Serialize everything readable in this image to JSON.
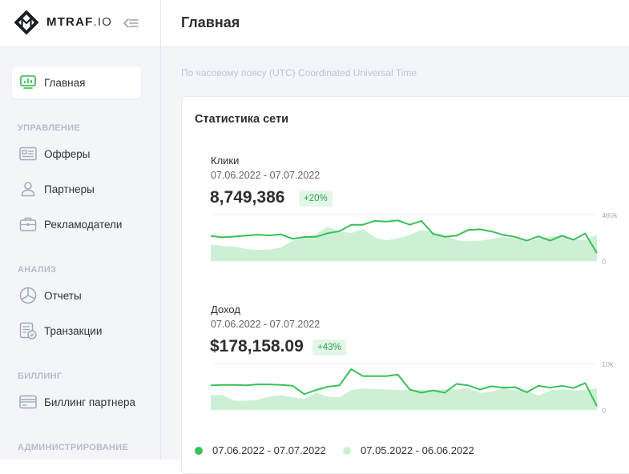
{
  "brand": {
    "name_bold": "MTRAF",
    "name_thin": ".IO"
  },
  "sidebar": {
    "home": {
      "label": "Главная",
      "icon": "dashboard-icon"
    },
    "sections": [
      {
        "title": "УПРАВЛЕНИЕ",
        "items": [
          {
            "label": "Офферы",
            "icon": "offers-card-icon"
          },
          {
            "label": "Партнеры",
            "icon": "user-icon"
          },
          {
            "label": "Рекламодатели",
            "icon": "briefcase-icon"
          }
        ]
      },
      {
        "title": "АНАЛИЗ",
        "items": [
          {
            "label": "Отчеты",
            "icon": "pie-chart-icon"
          },
          {
            "label": "Транзакции",
            "icon": "transactions-icon"
          }
        ]
      },
      {
        "title": "БИЛЛИНГ",
        "items": [
          {
            "label": "Биллинг партнера",
            "icon": "credit-card-icon"
          }
        ]
      },
      {
        "title": "АДМИНИСТРИРОВАНИЕ",
        "items": []
      }
    ]
  },
  "header": {
    "title": "Главная"
  },
  "main": {
    "timezone_note": "По часовому поясу (UTC) Coordinated Universal Time",
    "card": {
      "title": "Статистика сети",
      "metrics": [
        {
          "label": "Клики",
          "date_range": "07.06.2022 - 07.07.2022",
          "value": "8,749,386",
          "change": "+20%",
          "y_max_label": "480k",
          "y_min_label": "0"
        },
        {
          "label": "Доход",
          "date_range": "07.06.2022 - 07.07.2022",
          "value": "$178,158.09",
          "change": "+43%",
          "y_max_label": "10k",
          "y_min_label": "0"
        }
      ],
      "legend": [
        {
          "label": "07.06.2022 - 07.07.2022",
          "color": "#39c05a"
        },
        {
          "label": "07.05.2022 - 06.06.2022",
          "color": "#cdf0d5"
        }
      ]
    }
  },
  "chart_data": [
    {
      "type": "area",
      "title": "Клики",
      "ylim": [
        0,
        480000
      ],
      "series": [
        {
          "name": "07.06.2022 - 07.07.2022",
          "values": [
            260000,
            245000,
            252000,
            262000,
            272000,
            265000,
            275000,
            230000,
            248000,
            250000,
            288000,
            308000,
            375000,
            375000,
            415000,
            408000,
            420000,
            375000,
            415000,
            280000,
            250000,
            262000,
            320000,
            328000,
            305000,
            270000,
            250000,
            210000,
            255000,
            210000,
            262000,
            220000,
            285000,
            80000
          ]
        },
        {
          "name": "07.05.2022 - 06.06.2022",
          "values": [
            170000,
            155000,
            150000,
            125000,
            115000,
            118000,
            140000,
            210000,
            245000,
            280000,
            355000,
            305000,
            290000,
            330000,
            245000,
            215000,
            235000,
            270000,
            320000,
            300000,
            270000,
            215000,
            205000,
            210000,
            230000,
            245000,
            240000,
            205000,
            230000,
            255000,
            260000,
            230000,
            215000,
            270000
          ]
        }
      ]
    },
    {
      "type": "area",
      "title": "Доход",
      "ylim": [
        0,
        10000
      ],
      "series": [
        {
          "name": "07.06.2022 - 07.07.2022",
          "values": [
            5300,
            5400,
            5400,
            5300,
            5500,
            5500,
            5400,
            5200,
            3400,
            4300,
            5000,
            5300,
            8800,
            7300,
            7300,
            7300,
            7600,
            4400,
            3700,
            4200,
            3700,
            5600,
            5300,
            4400,
            5100,
            4800,
            4900,
            3800,
            5200,
            4800,
            5200,
            4700,
            5800,
            800
          ]
        },
        {
          "name": "07.05.2022 - 06.06.2022",
          "values": [
            3200,
            3200,
            2000,
            2000,
            2200,
            2900,
            3200,
            2700,
            2400,
            3700,
            2900,
            2700,
            4300,
            4600,
            4500,
            4400,
            4300,
            4300,
            4400,
            4200,
            4500,
            4400,
            4700,
            3700,
            3900,
            4700,
            4200,
            4200,
            3100,
            4200,
            4500,
            4200,
            4300,
            4600
          ]
        }
      ]
    }
  ]
}
